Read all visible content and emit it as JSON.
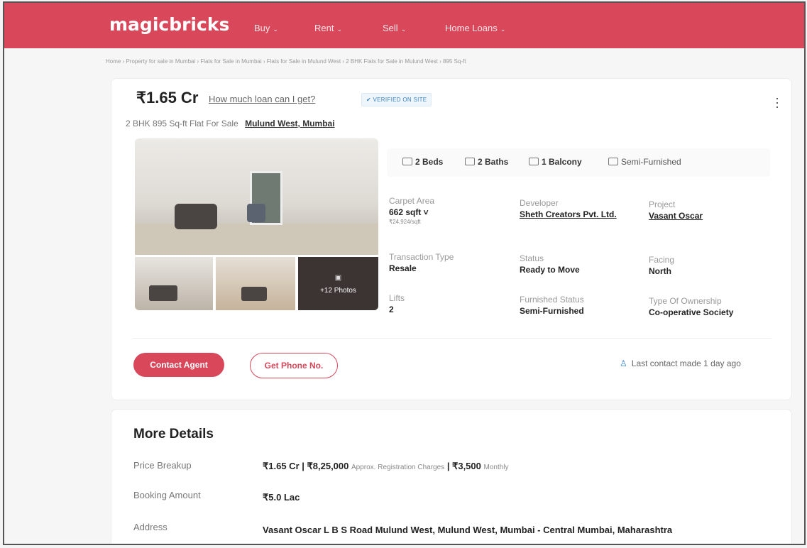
{
  "header": {
    "logo": "magicbricks",
    "nav": [
      {
        "label": "Buy"
      },
      {
        "label": "Rent"
      },
      {
        "label": "Sell"
      },
      {
        "label": "Home Loans"
      }
    ],
    "brand_color": "#d8475a"
  },
  "breadcrumb": "Home › Property for sale in Mumbai › Flats for Sale in Mumbai › Flats for Sale in Mulund West › 2 BHK Flats for Sale in Mulund West › 895 Sq-ft",
  "listing": {
    "price": "₹1.65 Cr",
    "loan_link": "How much loan can I get?",
    "verified": "✔ VERIFIED ON SITE",
    "title": "2 BHK 895 Sq-ft Flat For Sale",
    "location": "Mulund West, Mumbai",
    "photos_label": "+12 Photos",
    "features": {
      "beds": "2 Beds",
      "baths": "2 Baths",
      "balcony": "1 Balcony",
      "furnishing": "Semi-Furnished"
    },
    "specs": {
      "carpet_area_label": "Carpet Area",
      "carpet_area_value": "662 sqft ˅",
      "carpet_area_rate": "₹24,924/sqft",
      "developer_label": "Developer",
      "developer_value": "Sheth Creators Pvt. Ltd.",
      "project_label": "Project",
      "project_value": "Vasant Oscar",
      "transaction_label": "Transaction Type",
      "transaction_value": "Resale",
      "status_label": "Status",
      "status_value": "Ready to Move",
      "facing_label": "Facing",
      "facing_value": "North",
      "lifts_label": "Lifts",
      "lifts_value": "2",
      "furnished_label": "Furnished Status",
      "furnished_value": "Semi-Furnished",
      "ownership_label": "Type Of Ownership",
      "ownership_value": "Co-operative Society"
    },
    "contact_button": "Contact Agent",
    "phone_button": "Get Phone No.",
    "last_contact": "Last contact made 1 day ago"
  },
  "more_details": {
    "title": "More Details",
    "price_breakup_label": "Price Breakup",
    "price_breakup_value": "₹1.65 Cr | ₹8,25,000",
    "price_breakup_note1": "Approx. Registration Charges",
    "price_breakup_value2": "| ₹3,500",
    "price_breakup_note2": "Monthly",
    "booking_label": "Booking Amount",
    "booking_value": "₹5.0 Lac",
    "address_label": "Address",
    "address_value": "Vasant Oscar L B S Road Mulund West, Mulund West, Mumbai - Central Mumbai, Maharashtra"
  }
}
